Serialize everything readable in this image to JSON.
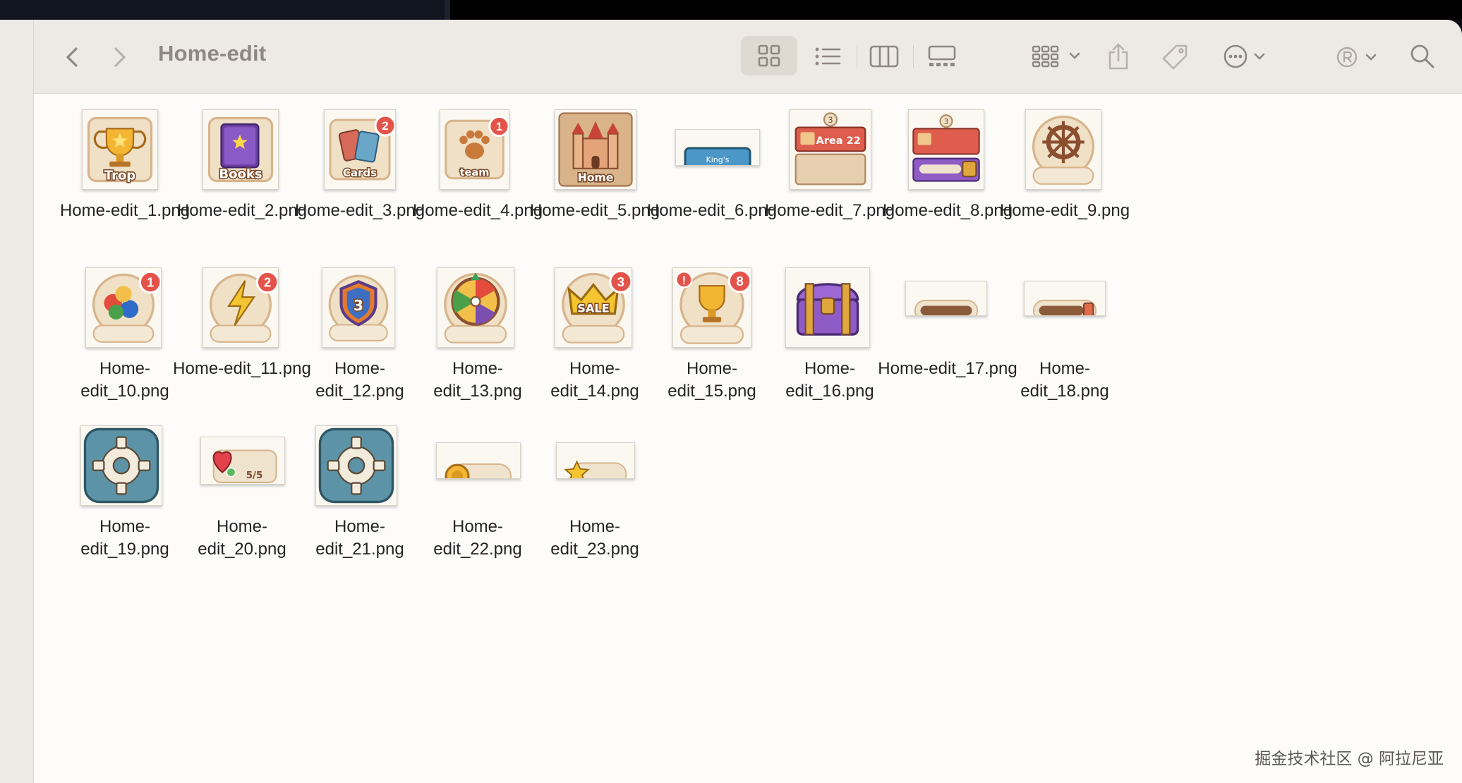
{
  "window": {
    "folder_title": "Home-edit"
  },
  "toolbar": {
    "icons": [
      "back-icon",
      "forward-icon",
      "icon-view-icon",
      "list-view-icon",
      "column-view-icon",
      "gallery-view-icon",
      "group-icon",
      "share-icon",
      "tag-icon",
      "more-icon",
      "account-icon",
      "search-icon"
    ]
  },
  "files": [
    {
      "name": "Home-edit_1.png",
      "icon": "trophy",
      "label": "Trop"
    },
    {
      "name": "Home-edit_2.png",
      "icon": "books",
      "label": "Books"
    },
    {
      "name": "Home-edit_3.png",
      "icon": "cards",
      "label": "Cards",
      "badge": "2"
    },
    {
      "name": "Home-edit_4.png",
      "icon": "paw",
      "label": "team",
      "badge": "1"
    },
    {
      "name": "Home-edit_5.png",
      "icon": "castle",
      "label": "Home"
    },
    {
      "name": "Home-edit_6.png",
      "icon": "banner",
      "label": "King's Nightmare"
    },
    {
      "name": "Home-edit_7.png",
      "icon": "area-panel",
      "label": "Area 22",
      "top_number": "3"
    },
    {
      "name": "Home-edit_8.png",
      "icon": "area-panel-chest",
      "top_number": "3"
    },
    {
      "name": "Home-edit_9.png",
      "icon": "wheel"
    },
    {
      "name": "Home-edit_10.png",
      "icon": "balls",
      "badge": "1"
    },
    {
      "name": "Home-edit_11.png",
      "icon": "lightning",
      "badge": "2"
    },
    {
      "name": "Home-edit_12.png",
      "icon": "shield",
      "label": "3"
    },
    {
      "name": "Home-edit_13.png",
      "icon": "spin-wheel"
    },
    {
      "name": "Home-edit_14.png",
      "icon": "crown",
      "label": "SALE",
      "badge": "3"
    },
    {
      "name": "Home-edit_15.png",
      "icon": "cup",
      "badge": "8",
      "alert": "!"
    },
    {
      "name": "Home-edit_16.png",
      "icon": "chest"
    },
    {
      "name": "Home-edit_17.png",
      "icon": "bar"
    },
    {
      "name": "Home-edit_18.png",
      "icon": "bar-chest"
    },
    {
      "name": "Home-edit_19.png",
      "icon": "gear"
    },
    {
      "name": "Home-edit_20.png",
      "icon": "heart-bar",
      "label": "5/5"
    },
    {
      "name": "Home-edit_21.png",
      "icon": "gear"
    },
    {
      "name": "Home-edit_22.png",
      "icon": "coin-bar"
    },
    {
      "name": "Home-edit_23.png",
      "icon": "star-bar"
    }
  ],
  "watermark": "掘金技术社区 @ 阿拉尼亚"
}
